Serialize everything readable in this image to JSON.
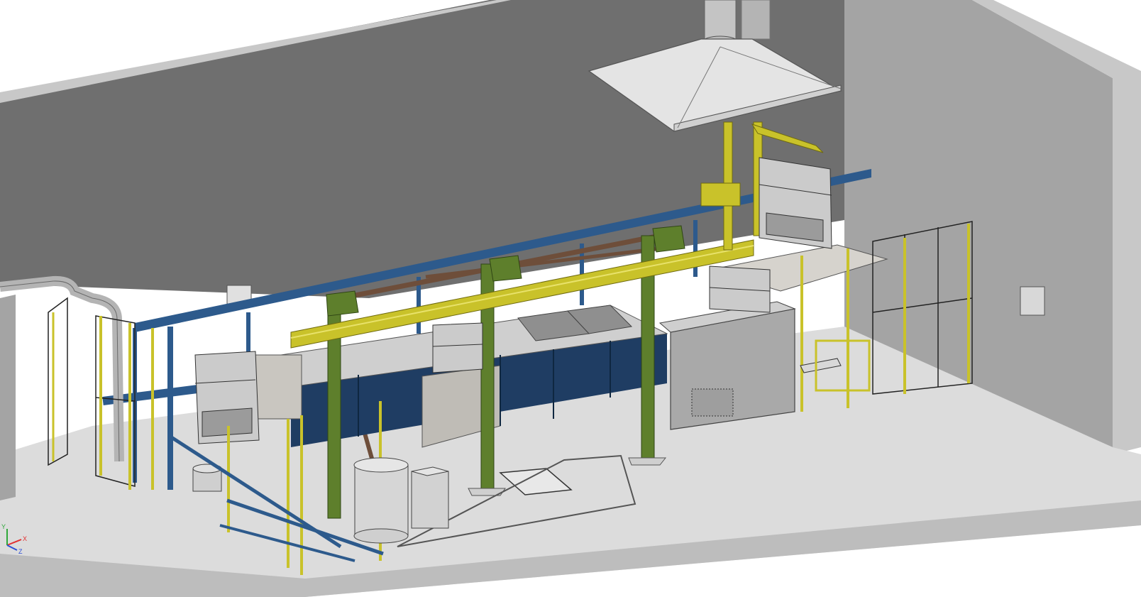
{
  "viewport": {
    "background": "#ffffff"
  },
  "colors": {
    "wall_dark": "#6f6f6f",
    "wall_light": "#a4a4a4",
    "wall_edge": "#c8c8c8",
    "floor": "#dcdcdc",
    "frame_blue": "#2d5a8c",
    "tank_blue": "#1f3d63",
    "gantry_yellow": "#c9c22a",
    "column_green": "#5e7f2c",
    "brown_brace": "#6e4e3a",
    "steel_light": "#d2d2d2",
    "hood": "#e4e4e4",
    "duct": "#b4b4b4"
  },
  "triad": {
    "x_label": "X",
    "y_label": "Y",
    "z_label": "Z",
    "x_color": "#e23030",
    "y_color": "#2fa83a",
    "z_color": "#2d4fd6"
  }
}
